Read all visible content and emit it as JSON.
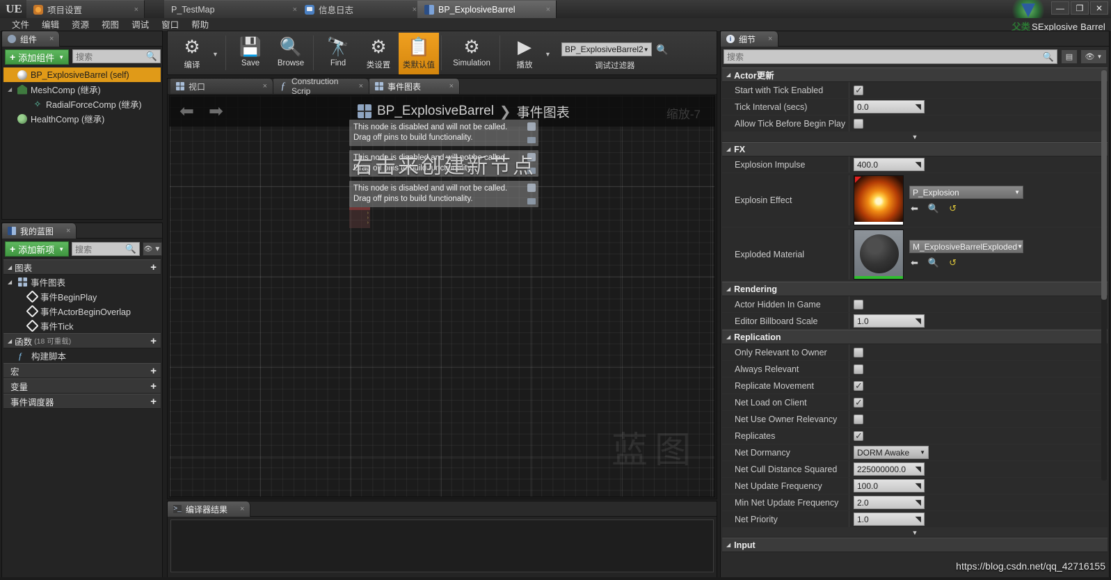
{
  "window": {
    "logo": "UE",
    "minimize": "—",
    "maximize": "❐",
    "close": "✕",
    "watermark_cn": "父类",
    "watermark_title": "SExplosive Barrel"
  },
  "tabs": [
    {
      "label": "项目设置",
      "icon": "gear-orange-icon",
      "active": false,
      "close": "×"
    },
    {
      "label": "P_TestMap",
      "icon": "none",
      "active": false,
      "close": "×"
    },
    {
      "label": "信息日志",
      "icon": "speech-bubble-icon",
      "active": false,
      "close": "×"
    },
    {
      "label": "BP_ExplosiveBarrel",
      "icon": "blueprint-book-icon",
      "active": true,
      "close": "×"
    }
  ],
  "menu": [
    "文件",
    "编辑",
    "资源",
    "视图",
    "调试",
    "窗口",
    "帮助"
  ],
  "components_panel": {
    "tab_title": "组件",
    "tab_close": "×",
    "add_button": "添加组件",
    "add_plus": "+",
    "add_caret": "▼",
    "search_placeholder": "搜索",
    "items": [
      {
        "label": "BP_ExplosiveBarrel (self)",
        "icon": "sphere-icon",
        "indent": 0,
        "selected": true,
        "arrow": ""
      },
      {
        "label": "MeshComp (继承)",
        "icon": "mesh-icon",
        "indent": 0,
        "selected": false,
        "arrow": "◢"
      },
      {
        "label": "RadialForceComp (继承)",
        "icon": "radial-force-icon",
        "indent": 1,
        "selected": false,
        "arrow": ""
      },
      {
        "label": "HealthComp (继承)",
        "icon": "health-icon",
        "indent": 0,
        "selected": false,
        "arrow": ""
      }
    ]
  },
  "myblueprint_panel": {
    "tab_title": "我的蓝图",
    "tab_close": "×",
    "add_button": "添加新项",
    "add_plus": "+",
    "add_caret": "▼",
    "search_placeholder": "搜索",
    "eye_icon": "eye-icon",
    "eye_caret": "▼",
    "sections": [
      {
        "name": "图表",
        "sub": "",
        "plus": "+",
        "tri": "◢",
        "items": [
          {
            "label": "事件图表",
            "icon": "graph-icon",
            "indent": 0,
            "tri": "◢"
          },
          {
            "label": "事件BeginPlay",
            "icon": "event-diamond-icon",
            "indent": 1,
            "tri": ""
          },
          {
            "label": "事件ActorBeginOverlap",
            "icon": "event-diamond-icon",
            "indent": 1,
            "tri": ""
          },
          {
            "label": "事件Tick",
            "icon": "event-diamond-icon",
            "indent": 1,
            "tri": ""
          }
        ]
      },
      {
        "name": "函数",
        "sub": "(18 可重载)",
        "plus": "+",
        "tri": "◢",
        "items": [
          {
            "label": "构建脚本",
            "icon": "function-icon",
            "indent": 0,
            "tri": ""
          }
        ]
      },
      {
        "name": "宏",
        "sub": "",
        "plus": "+",
        "tri": "",
        "items": []
      },
      {
        "name": "变量",
        "sub": "",
        "plus": "+",
        "tri": "",
        "items": []
      },
      {
        "name": "事件调度器",
        "sub": "",
        "plus": "+",
        "tri": "",
        "items": []
      }
    ]
  },
  "toolbar": {
    "items": [
      {
        "label": "编译",
        "icon": "compile-gear-check-icon",
        "highlight": false,
        "caret": true,
        "wide": false
      },
      {
        "label": "Save",
        "icon": "floppy-save-icon",
        "highlight": false,
        "caret": false,
        "wide": false
      },
      {
        "label": "Browse",
        "icon": "browse-magnifier-icon",
        "highlight": false,
        "caret": false,
        "wide": false
      },
      {
        "label": "Find",
        "icon": "find-binoculars-icon",
        "highlight": false,
        "caret": false,
        "wide": false
      },
      {
        "label": "类设置",
        "icon": "class-settings-gear-icon",
        "highlight": false,
        "caret": false,
        "wide": false
      },
      {
        "label": "类默认值",
        "icon": "class-defaults-icon",
        "highlight": true,
        "caret": false,
        "wide": false
      },
      {
        "label": "Simulation",
        "icon": "simulation-icon",
        "highlight": false,
        "caret": false,
        "wide": true
      },
      {
        "label": "播放",
        "icon": "play-triangle-icon",
        "highlight": false,
        "caret": true,
        "wide": false
      }
    ],
    "debug_filter_value": "BP_ExplosiveBarrel2",
    "debug_filter_caret": "▼",
    "debug_filter_label": "调试过滤器",
    "debug_search_icon": "search-icon"
  },
  "graph_editor": {
    "tabs": [
      {
        "label": "视口",
        "icon": "viewport-icon",
        "active": false,
        "close": "×"
      },
      {
        "label": "Construction Scrip",
        "icon": "function-f-icon",
        "active": false,
        "close": "×"
      },
      {
        "label": "事件图表",
        "icon": "graph-icon",
        "active": true,
        "close": "×"
      }
    ],
    "nav_back": "⬅",
    "nav_forward": "➡",
    "breadcrumb_icon": "blueprint-graph-icon",
    "breadcrumb_root": "BP_ExplosiveBarrel",
    "breadcrumb_sep": "❯",
    "breadcrumb_current": "事件图表",
    "zoom_label": "缩放-7",
    "hint_text": "右击来创建新节点",
    "watermark": "蓝图",
    "tooltips": [
      {
        "line1": "This node is disabled and will not be called.",
        "line2": "Drag off pins to build functionality."
      },
      {
        "line1": "This node is disabled and will not be called.",
        "line2": "Drag off pins to build functionality."
      },
      {
        "line1": "This node is disabled and will not be called.",
        "line2": "Drag off pins to build functionality."
      }
    ]
  },
  "compiler_panel": {
    "tab_title": "编译器结果",
    "tab_close": "×",
    "icon": "console-icon",
    "content": ""
  },
  "details_panel": {
    "tab_title": "细节",
    "tab_close": "×",
    "icon": "info-icon",
    "search_placeholder": "搜索",
    "grid_button_icon": "grid-view-icon",
    "eye_button_icon": "eye-icon",
    "eye_caret": "▼",
    "categories": [
      {
        "name": "Actor更新",
        "tri": "◢",
        "rows": [
          {
            "label": "Start with Tick Enabled",
            "type": "checkbox",
            "value": true
          },
          {
            "label": "Tick Interval (secs)",
            "type": "number",
            "value": "0.0"
          },
          {
            "label": "Allow Tick Before Begin Play",
            "type": "checkbox",
            "value": false
          }
        ],
        "expander": "▼"
      },
      {
        "name": "FX",
        "tri": "◢",
        "rows": [
          {
            "label": "Explosion Impulse",
            "type": "number",
            "value": "400.0"
          },
          {
            "label": "Explosin Effect",
            "type": "asset",
            "value": "P_Explosion",
            "thumb": "fire",
            "caret": "▼"
          },
          {
            "label": "Exploded Material",
            "type": "asset",
            "value": "M_ExplosiveBarrelExploded",
            "thumb": "matball",
            "caret": "▼"
          }
        ],
        "expander": ""
      },
      {
        "name": "Rendering",
        "tri": "◢",
        "rows": [
          {
            "label": "Actor Hidden In Game",
            "type": "checkbox",
            "value": false
          },
          {
            "label": "Editor Billboard Scale",
            "type": "number",
            "value": "1.0"
          }
        ],
        "expander": ""
      },
      {
        "name": "Replication",
        "tri": "◢",
        "rows": [
          {
            "label": "Only Relevant to Owner",
            "type": "checkbox",
            "value": false
          },
          {
            "label": "Always Relevant",
            "type": "checkbox",
            "value": false
          },
          {
            "label": "Replicate Movement",
            "type": "checkbox",
            "value": true
          },
          {
            "label": "Net Load on Client",
            "type": "checkbox",
            "value": true
          },
          {
            "label": "Net Use Owner Relevancy",
            "type": "checkbox",
            "value": false
          },
          {
            "label": "Replicates",
            "type": "checkbox",
            "value": true
          },
          {
            "label": "Net Dormancy",
            "type": "combo",
            "value": "DORM Awake",
            "caret": "▼"
          },
          {
            "label": "Net Cull Distance Squared",
            "type": "number",
            "value": "225000000.0"
          },
          {
            "label": "Net Update Frequency",
            "type": "number",
            "value": "100.0"
          },
          {
            "label": "Min Net Update Frequency",
            "type": "number",
            "value": "2.0"
          },
          {
            "label": "Net Priority",
            "type": "number",
            "value": "1.0"
          }
        ],
        "expander": "▼"
      },
      {
        "name": "Input",
        "tri": "◢",
        "rows": [],
        "expander": ""
      }
    ],
    "asset_buttons": {
      "back": "⬅",
      "find": "🔍",
      "reset": "↺"
    }
  },
  "overlay_url": "https://blog.csdn.net/qq_42716155"
}
